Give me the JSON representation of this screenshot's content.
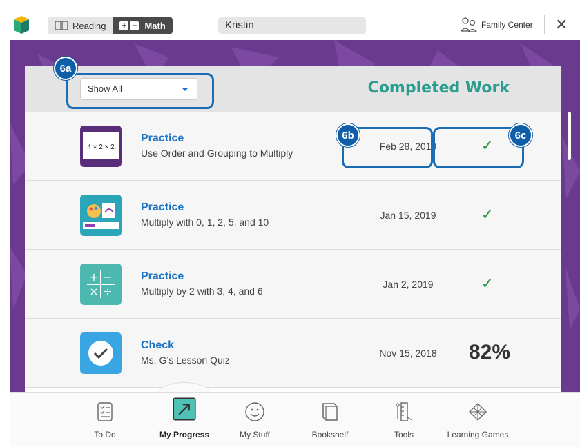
{
  "topbar": {
    "tabs": [
      {
        "label": "Reading",
        "icon": "book-icon"
      },
      {
        "label": "Math",
        "icon": "plus-minus-icon"
      }
    ],
    "student_name": "Kristin",
    "family_center": "Family Center"
  },
  "panel": {
    "filter_value": "Show All",
    "title": "Completed Work",
    "rows": [
      {
        "type": "Practice",
        "desc": "Use Order and Grouping to Multiply",
        "date": "Feb 28, 2019",
        "status": "✓",
        "icon": "4 × 2 × 2"
      },
      {
        "type": "Practice",
        "desc": "Multiply with 0, 1, 2, 5, and 10",
        "date": "Jan 15, 2019",
        "status": "✓"
      },
      {
        "type": "Practice",
        "desc": "Multiply by 2 with 3, 4, and 6",
        "date": "Jan 2, 2019",
        "status": "✓"
      },
      {
        "type": "Check",
        "desc": "Ms. G’s Lesson Quiz",
        "date": "Nov 15, 2018",
        "score": "82%"
      }
    ]
  },
  "callouts": {
    "a": "6a",
    "b": "6b",
    "c": "6c"
  },
  "nav": [
    {
      "label": "To Do",
      "icon": "checklist-icon"
    },
    {
      "label": "My Progress",
      "icon": "progress-arrow-icon",
      "active": true
    },
    {
      "label": "My Stuff",
      "icon": "smiley-icon"
    },
    {
      "label": "Bookshelf",
      "icon": "book-icon"
    },
    {
      "label": "Tools",
      "icon": "ruler-icon"
    },
    {
      "label": "Learning Games",
      "icon": "triangles-icon"
    }
  ],
  "colors": {
    "purple": "#6a3a8f",
    "teal": "#2a9d8f",
    "blue": "#1a73c5",
    "green": "#239a3f"
  }
}
